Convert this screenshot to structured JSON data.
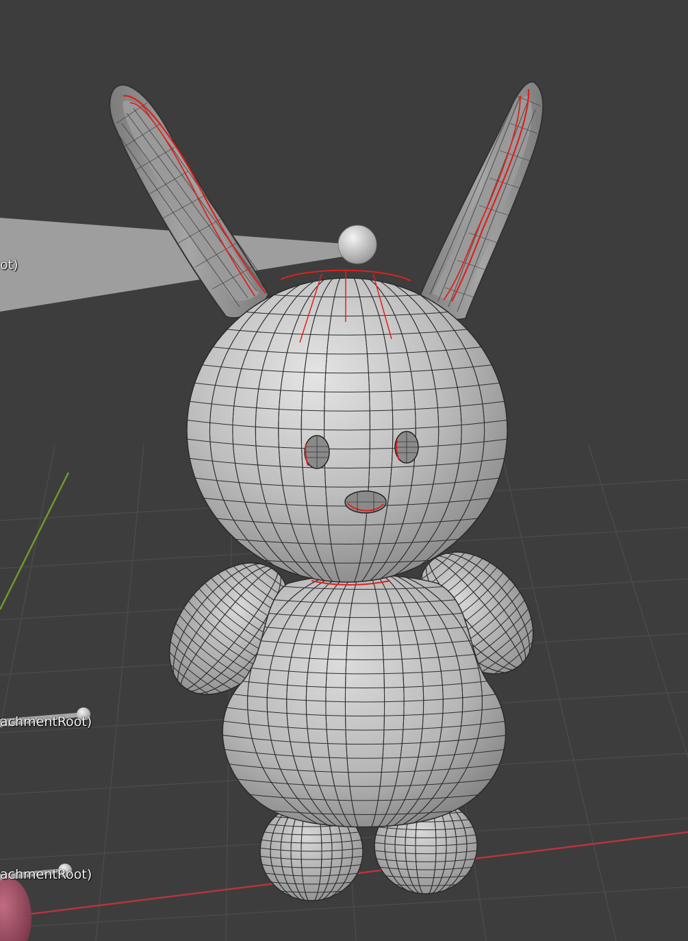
{
  "viewport": {
    "background": "#3d3d3d",
    "grid_color": "#4a4a4a",
    "x_axis_color": "#b8333f",
    "y_axis_color": "#6f9a2e",
    "mesh_color": "#bdbdbd",
    "wire_color": "#222222",
    "seam_color": "#e0201c"
  },
  "object_labels": {
    "root": "ot)",
    "attachment_1": "achmentRoot)",
    "attachment_2": "achmentRoot)"
  },
  "icons": {
    "bunny_mesh": "bunny-mesh",
    "empty_sphere": "sphere-empty-icon"
  }
}
